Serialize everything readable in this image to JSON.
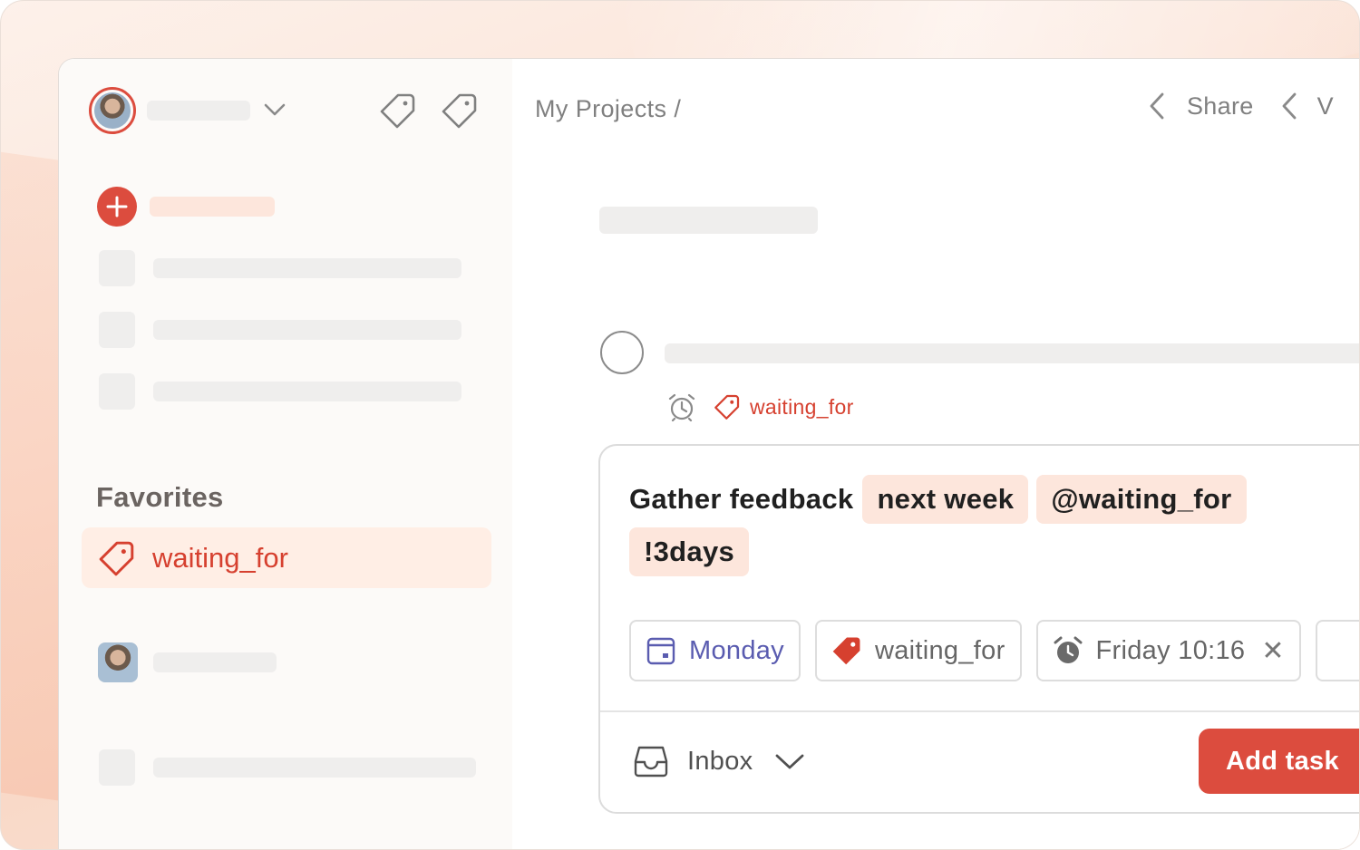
{
  "header": {
    "breadcrumb": "My Projects /",
    "share_label": "Share",
    "truncated_label": "V"
  },
  "sidebar": {
    "favorites_title": "Favorites",
    "favorite_item": "waiting_for"
  },
  "task": {
    "label_tag": "waiting_for"
  },
  "editor": {
    "text": "Gather feedback",
    "tokens": [
      "next week",
      "@waiting_for",
      "!3days"
    ],
    "due_pill": "Monday",
    "label_pill": "waiting_for",
    "reminder_pill": "Friday 10:16",
    "remove_symbol": "✕",
    "project": "Inbox",
    "submit_label": "Add task"
  },
  "colors": {
    "accent": "#dc4c3e",
    "chip_bg": "#fde6dc",
    "due_purple": "#5a5cb0",
    "sidebar_bg": "#fcfaf8"
  },
  "icons": [
    "tag-icon",
    "chevron-down-icon",
    "chevron-left-icon",
    "plus-icon",
    "alarm-icon",
    "calendar-icon",
    "inbox-icon",
    "close-icon"
  ]
}
